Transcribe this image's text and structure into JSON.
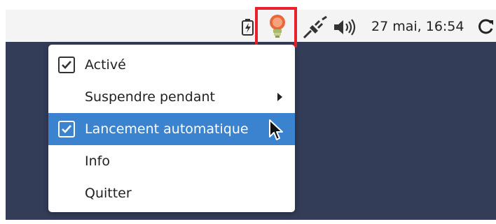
{
  "panel": {
    "clock": "27 mai, 16:54",
    "icons": [
      "battery-charging-icon",
      "redshift-bulb-icon",
      "network-plug-icon",
      "volume-icon",
      "refresh-icon"
    ]
  },
  "menu": {
    "items": [
      {
        "label": "Activé",
        "checked": true
      },
      {
        "label": "Suspendre pendant",
        "submenu": true
      },
      {
        "label": "Lancement automatique",
        "checked": true,
        "highlighted": true
      },
      {
        "label": "Info"
      },
      {
        "label": "Quitter"
      }
    ]
  },
  "colors": {
    "panel_bg": "#f4f4f4",
    "desktop_bg": "#343d58",
    "highlight": "#3b82cf",
    "annotation_box": "#e8222a"
  }
}
